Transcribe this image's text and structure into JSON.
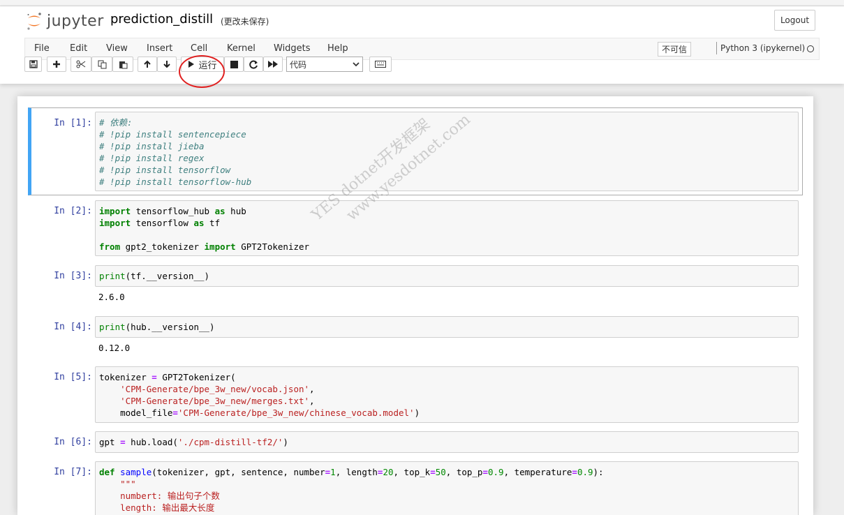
{
  "header": {
    "logo_text": "jupyter",
    "notebook_name": "prediction_distill",
    "save_status": "(更改未保存)",
    "logout_label": "Logout"
  },
  "menu": {
    "items": [
      "File",
      "Edit",
      "View",
      "Insert",
      "Cell",
      "Kernel",
      "Widgets",
      "Help"
    ],
    "trusted": "不可信",
    "kernel_name": "Python 3 (ipykernel)"
  },
  "toolbar": {
    "run_label": "运行",
    "cell_type": "代码"
  },
  "colors": {
    "selected_cell_border": "#42a5f5",
    "prompt": "#303f9f",
    "annotation_circle": "#e02020"
  },
  "cells": [
    {
      "prompt": "In  [1]:",
      "lines": [
        "# 依赖:",
        "# !pip install sentencepiece",
        "# !pip install jieba",
        "# !pip install regex",
        "# !pip install tensorflow",
        "# !pip install tensorflow-hub"
      ]
    },
    {
      "prompt": "In  [2]:",
      "lines": [
        "import tensorflow_hub as hub",
        "import tensorflow as tf",
        "",
        "from gpt2_tokenizer import GPT2Tokenizer"
      ]
    },
    {
      "prompt": "In  [3]:",
      "lines": [
        "print(tf.__version__)"
      ],
      "output": "2.6.0"
    },
    {
      "prompt": "In  [4]:",
      "lines": [
        "print(hub.__version__)"
      ],
      "output": "0.12.0"
    },
    {
      "prompt": "In  [5]:",
      "lines": [
        "tokenizer = GPT2Tokenizer(",
        "    'CPM-Generate/bpe_3w_new/vocab.json',",
        "    'CPM-Generate/bpe_3w_new/merges.txt',",
        "    model_file='CPM-Generate/bpe_3w_new/chinese_vocab.model')"
      ]
    },
    {
      "prompt": "In  [6]:",
      "lines": [
        "gpt = hub.load('./cpm-distill-tf2/')"
      ]
    },
    {
      "prompt": "In  [7]:",
      "lines": [
        "def sample(tokenizer, gpt, sentence, number=1, length=20, top_k=50, top_p=0.9, temperature=0.9):",
        "    \"\"\"",
        "    numbert: 输出句子个数",
        "    length: 输出最大长度"
      ]
    }
  ],
  "watermark": {
    "line1": "YES dotnet开发框架",
    "line2": "www.yesdotnet.com"
  }
}
